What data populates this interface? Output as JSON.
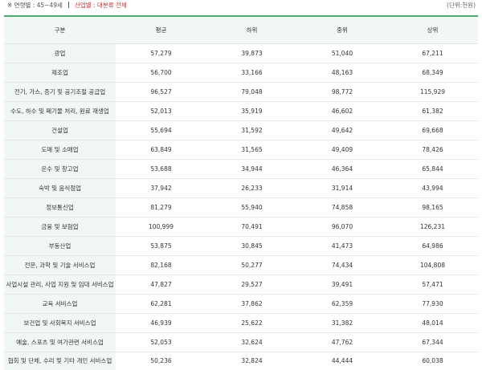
{
  "filters": {
    "age_label": "※ 연령별 : 45~49세",
    "industry_label": "산업별 : 대분류 전체"
  },
  "unit_label": "(단위:천원)",
  "colors": {
    "accent": "#4aa96c",
    "highlight": "#d0312d",
    "row_header_bg": "#f1f8f3"
  },
  "table": {
    "headers": [
      "구분",
      "평균",
      "하위",
      "중위",
      "상위"
    ],
    "rows": [
      {
        "name": "광업",
        "values": [
          "57,279",
          "39,873",
          "51,040",
          "67,211"
        ]
      },
      {
        "name": "제조업",
        "values": [
          "56,700",
          "33,166",
          "48,163",
          "68,349"
        ]
      },
      {
        "name": "전기, 가스, 증기 및 공기조절 공급업",
        "values": [
          "96,527",
          "79,048",
          "98,772",
          "115,929"
        ]
      },
      {
        "name": "수도, 하수 및 폐기물 처리, 원료 재생업",
        "values": [
          "52,013",
          "35,919",
          "46,602",
          "61,382"
        ]
      },
      {
        "name": "건설업",
        "values": [
          "55,694",
          "31,592",
          "49,642",
          "69,668"
        ]
      },
      {
        "name": "도매 및 소매업",
        "values": [
          "63,849",
          "31,565",
          "49,409",
          "78,426"
        ]
      },
      {
        "name": "운수 및 창고업",
        "values": [
          "53,688",
          "34,944",
          "46,364",
          "65,844"
        ]
      },
      {
        "name": "숙박 및 음식점업",
        "values": [
          "37,942",
          "26,233",
          "31,914",
          "43,994"
        ]
      },
      {
        "name": "정보통신업",
        "values": [
          "81,279",
          "55,940",
          "74,858",
          "98,165"
        ]
      },
      {
        "name": "금융 및 보험업",
        "values": [
          "100,999",
          "70,491",
          "96,070",
          "126,231"
        ]
      },
      {
        "name": "부동산업",
        "values": [
          "53,875",
          "30,845",
          "41,473",
          "64,986"
        ]
      },
      {
        "name": "전문, 과학 및 기술 서비스업",
        "values": [
          "82,168",
          "50,277",
          "74,434",
          "104,808"
        ]
      },
      {
        "name": "사업시설 관리, 사업 지원 및 임대 서비스업",
        "values": [
          "47,827",
          "29,527",
          "39,491",
          "57,471"
        ]
      },
      {
        "name": "교육 서비스업",
        "values": [
          "62,281",
          "37,862",
          "62,359",
          "77,930"
        ]
      },
      {
        "name": "보건업 및 사회복지 서비스업",
        "values": [
          "46,939",
          "25,622",
          "31,382",
          "48,014"
        ]
      },
      {
        "name": "예술, 스포츠 및 여가관련 서비스업",
        "values": [
          "52,053",
          "32,624",
          "47,762",
          "67,344"
        ]
      },
      {
        "name": "협회 및 단체, 수리 및 기타 개인 서비스업",
        "values": [
          "50,236",
          "32,824",
          "44,444",
          "60,038"
        ]
      }
    ]
  }
}
